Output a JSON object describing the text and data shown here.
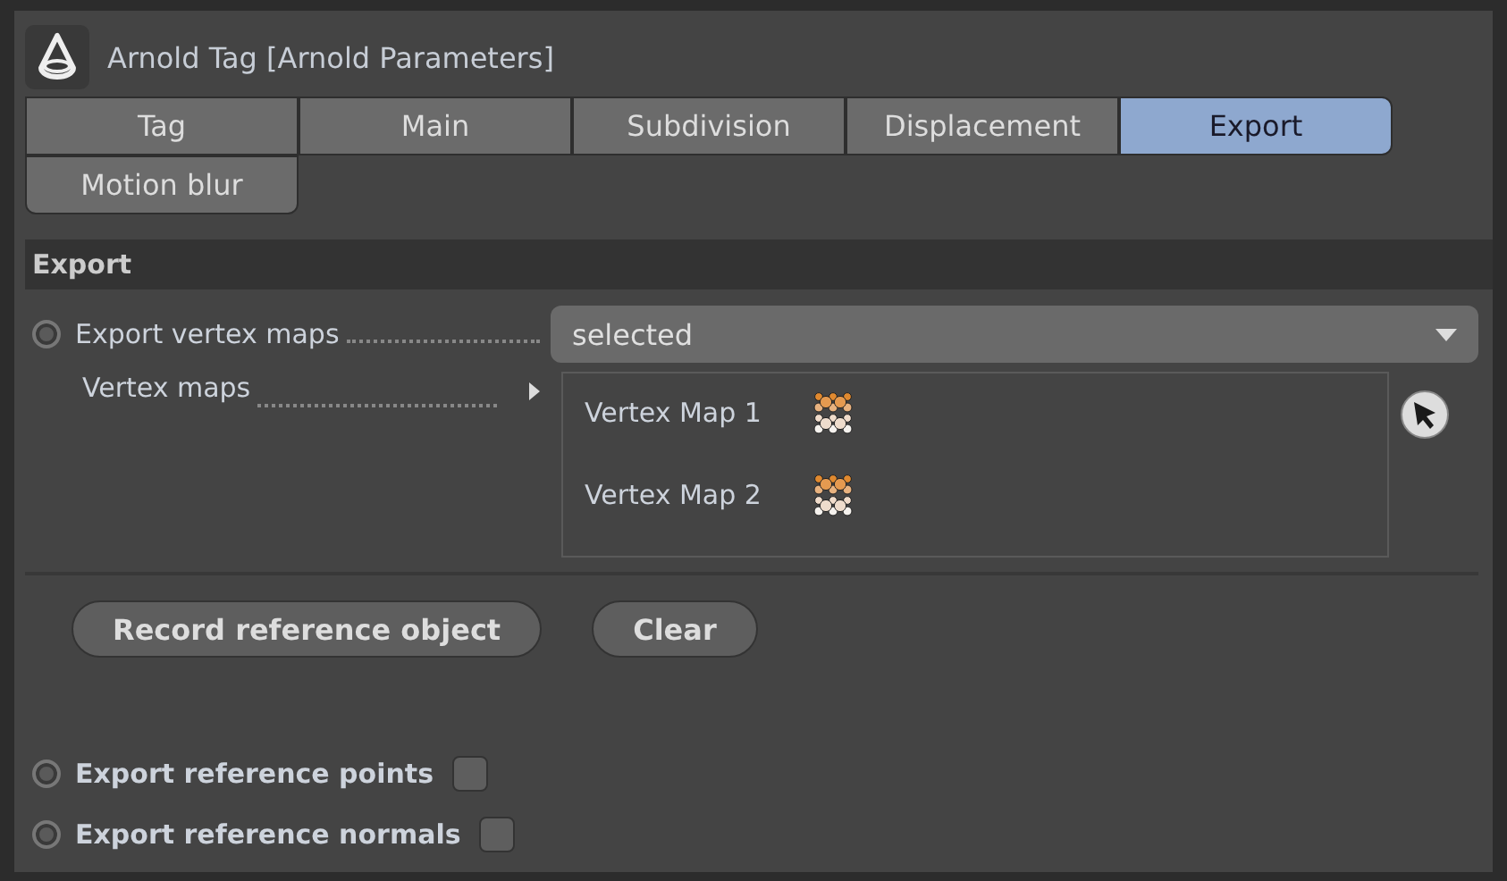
{
  "window": {
    "title": "Arnold Tag [Arnold Parameters]"
  },
  "tabs": [
    {
      "label": "Tag",
      "selected": false
    },
    {
      "label": "Main",
      "selected": false
    },
    {
      "label": "Subdivision",
      "selected": false
    },
    {
      "label": "Displacement",
      "selected": false
    },
    {
      "label": "Export",
      "selected": true
    },
    {
      "label": "Motion blur",
      "selected": false
    }
  ],
  "section": {
    "title": "Export"
  },
  "export_vertex_maps": {
    "label": "Export vertex maps",
    "animated": false,
    "value": "selected"
  },
  "vertex_maps": {
    "label": "Vertex maps",
    "items": [
      {
        "name": "Vertex Map 1"
      },
      {
        "name": "Vertex Map 2"
      }
    ]
  },
  "buttons": [
    "Record reference object",
    "Clear"
  ],
  "options": [
    {
      "label": "Export reference points",
      "animated": false,
      "checked": false
    },
    {
      "label": "Export reference normals",
      "animated": false,
      "checked": false
    }
  ]
}
